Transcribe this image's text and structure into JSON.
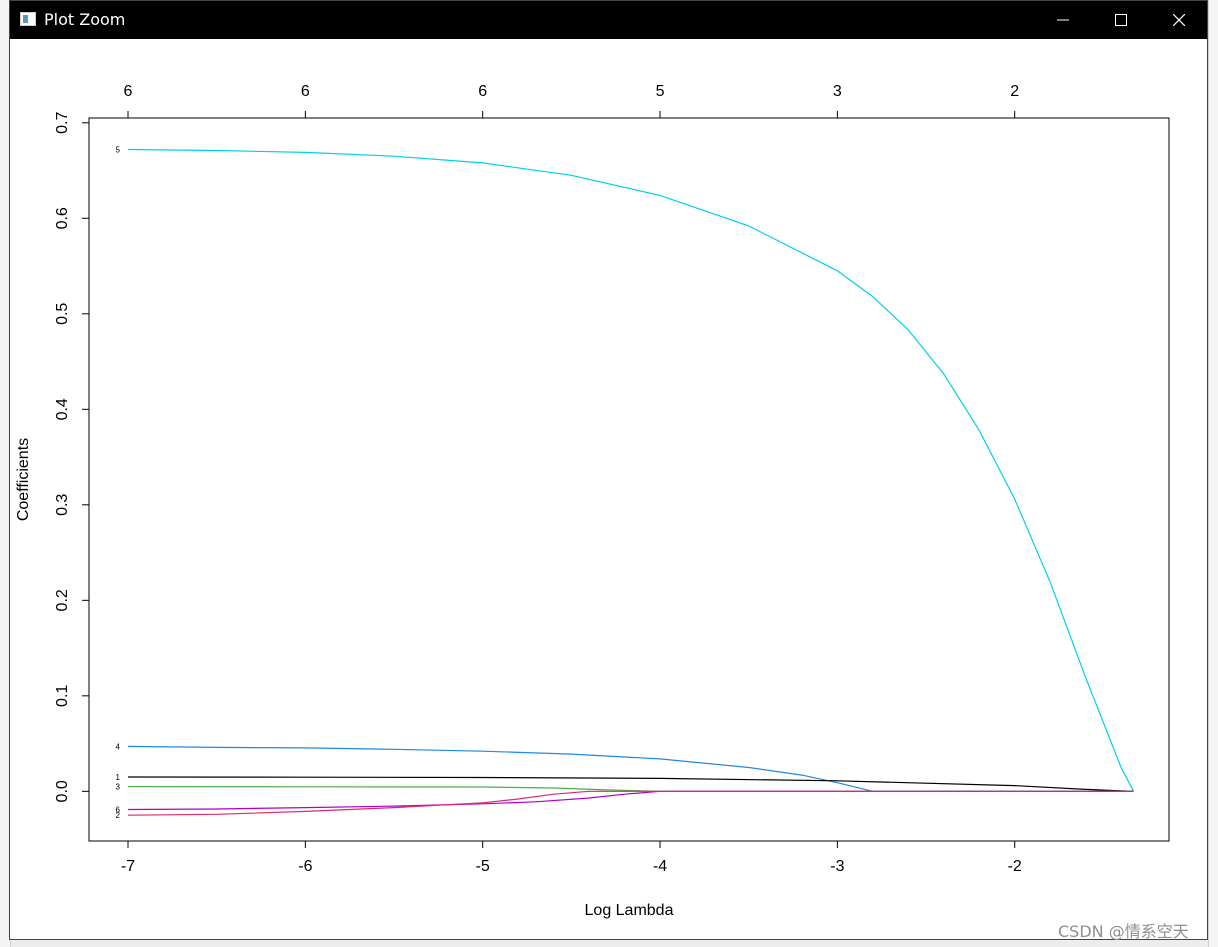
{
  "window": {
    "title": "Plot Zoom",
    "icons": {
      "app": "plot-window-icon",
      "minimize": "minimize-icon",
      "maximize": "maximize-icon",
      "close": "close-icon"
    }
  },
  "watermark": "CSDN @情系空天",
  "chart_data": {
    "type": "line",
    "title": "",
    "xlabel": "Log Lambda",
    "ylabel": "Coefficients",
    "xlim": [
      -7.22,
      -1.13
    ],
    "ylim": [
      -0.052,
      0.705
    ],
    "xticks": [
      -7,
      -6,
      -5,
      -4,
      -3,
      -2
    ],
    "xtick_labels": [
      "-7",
      "-6",
      "-5",
      "-4",
      "-3",
      "-2"
    ],
    "yticks": [
      0.0,
      0.1,
      0.2,
      0.3,
      0.4,
      0.5,
      0.6,
      0.7
    ],
    "ytick_labels": [
      "0.0",
      "0.1",
      "0.2",
      "0.3",
      "0.4",
      "0.5",
      "0.6",
      "0.7"
    ],
    "top_axis": {
      "ticks": [
        -7,
        -6,
        -5,
        -4,
        -3,
        -2
      ],
      "labels": [
        "6",
        "6",
        "6",
        "5",
        "3",
        "2"
      ]
    },
    "grid": false,
    "series": [
      {
        "name": "5",
        "color": "#00cfe8",
        "x": [
          -7.0,
          -6.5,
          -6.0,
          -5.5,
          -5.0,
          -4.5,
          -4.0,
          -3.5,
          -3.0,
          -2.8,
          -2.6,
          -2.4,
          -2.2,
          -2.0,
          -1.8,
          -1.6,
          -1.4,
          -1.33
        ],
        "y": [
          0.672,
          0.671,
          0.669,
          0.665,
          0.658,
          0.645,
          0.624,
          0.592,
          0.545,
          0.518,
          0.483,
          0.437,
          0.378,
          0.306,
          0.219,
          0.119,
          0.025,
          0.0
        ]
      },
      {
        "name": "4",
        "color": "#2288dd",
        "x": [
          -7.0,
          -6.5,
          -6.0,
          -5.5,
          -5.0,
          -4.5,
          -4.0,
          -3.5,
          -3.2,
          -3.0,
          -2.8,
          -1.33
        ],
        "y": [
          0.047,
          0.046,
          0.0455,
          0.044,
          0.042,
          0.039,
          0.034,
          0.025,
          0.017,
          0.009,
          0.0,
          0.0
        ]
      },
      {
        "name": "1",
        "color": "#000000",
        "x": [
          -7.0,
          -6.0,
          -5.0,
          -4.0,
          -3.0,
          -2.0,
          -1.6,
          -1.33
        ],
        "y": [
          0.015,
          0.0148,
          0.0145,
          0.0135,
          0.011,
          0.006,
          0.002,
          0.0
        ]
      },
      {
        "name": "3",
        "color": "#4daf4a",
        "x": [
          -7.0,
          -6.0,
          -5.0,
          -4.6,
          -4.3,
          -4.0,
          -1.33
        ],
        "y": [
          0.005,
          0.0048,
          0.0045,
          0.0035,
          0.0015,
          0.0,
          0.0
        ]
      },
      {
        "name": "6",
        "color": "#b000c8",
        "x": [
          -7.0,
          -6.5,
          -6.0,
          -5.5,
          -5.0,
          -4.7,
          -4.4,
          -4.2,
          -4.0,
          -3.8,
          -1.33
        ],
        "y": [
          -0.019,
          -0.0185,
          -0.017,
          -0.0155,
          -0.013,
          -0.011,
          -0.007,
          -0.003,
          0.0,
          0.0,
          0.0
        ]
      },
      {
        "name": "2",
        "color": "#d62d6a",
        "x": [
          -7.0,
          -6.5,
          -6.0,
          -5.5,
          -5.0,
          -4.8,
          -4.6,
          -4.4,
          -4.2,
          -4.0,
          -1.33
        ],
        "y": [
          -0.025,
          -0.024,
          -0.021,
          -0.017,
          -0.012,
          -0.008,
          -0.003,
          0.0,
          0.0,
          0.0,
          0.0
        ]
      }
    ],
    "line_labels": [
      {
        "text": "5",
        "y": 0.672
      },
      {
        "text": "4",
        "y": 0.047
      },
      {
        "text": "1",
        "y": 0.015
      },
      {
        "text": "3",
        "y": 0.005
      },
      {
        "text": "6",
        "y": -0.019
      },
      {
        "text": "2",
        "y": -0.025
      }
    ]
  }
}
